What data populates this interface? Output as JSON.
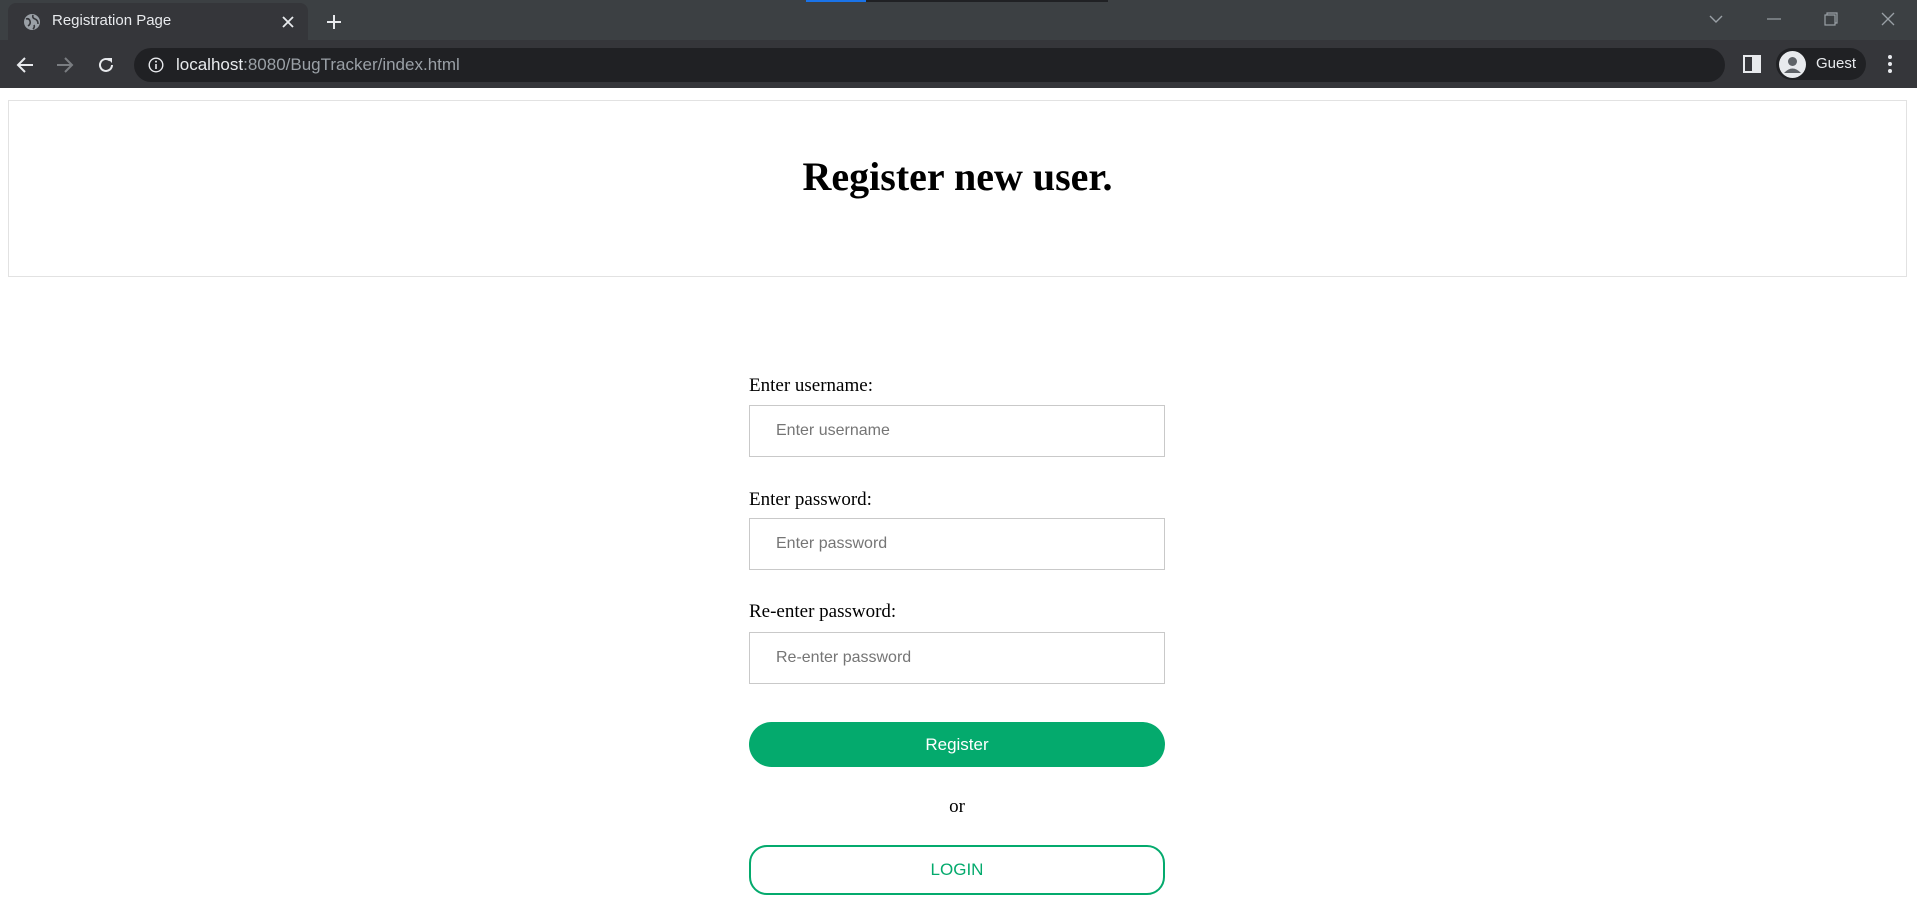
{
  "browser": {
    "tab": {
      "title": "Registration Page",
      "favicon": "globe-icon"
    },
    "omnibox": {
      "host": "localhost",
      "path": ":8080/BugTracker/index.html",
      "security_icon": "info-icon"
    },
    "profile": {
      "name": "Guest",
      "avatar_icon": "person-icon"
    },
    "colors": {
      "tabstrip": "#3c4043",
      "toolbar": "#35363a",
      "omnibox": "#202124",
      "text": "#e8eaed",
      "muted_text": "#9aa0a6",
      "loading": "#1a73e8"
    }
  },
  "page": {
    "title": "Register new user.",
    "form": {
      "username": {
        "label": "Enter username:",
        "placeholder": "Enter username",
        "value": ""
      },
      "password": {
        "label": "Enter password:",
        "placeholder": "Enter password",
        "value": ""
      },
      "confirm_password": {
        "label": "Re-enter password:",
        "placeholder": "Re-enter password",
        "value": ""
      },
      "register_label": "Register",
      "or_text": "or",
      "login_label": "LOGIN"
    },
    "colors": {
      "accent": "#04aa6d",
      "border": "#c9c9c9"
    }
  }
}
